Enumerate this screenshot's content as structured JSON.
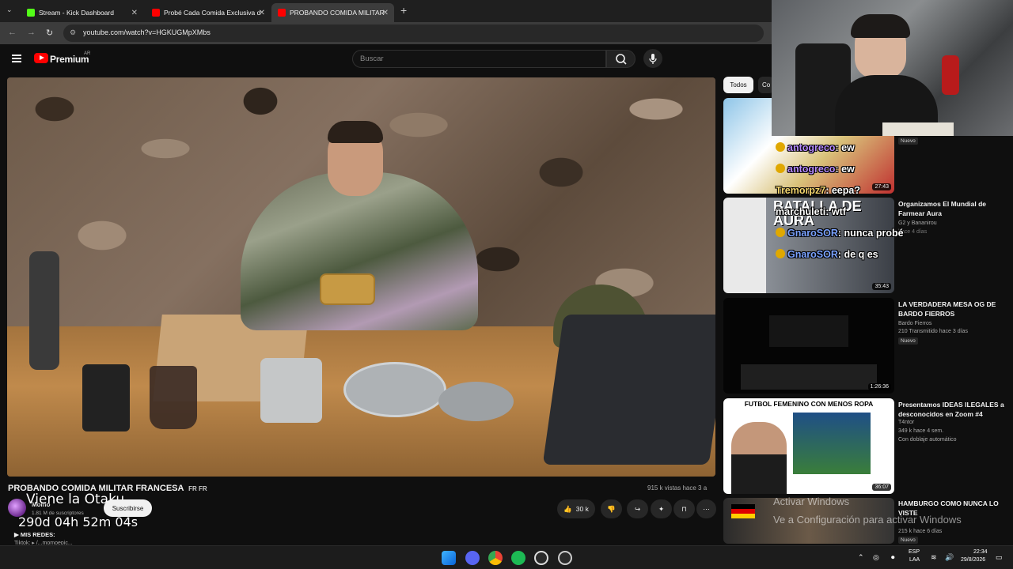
{
  "browser": {
    "tabs": [
      {
        "label": "Stream - Kick Dashboard",
        "favicon_color": "#53fc18"
      },
      {
        "label": "Probé Cada Comida Exclusiva d",
        "favicon_color": "#ff0000"
      },
      {
        "label": "PROBANDO COMIDA MILITAR",
        "favicon_color": "#ff0000"
      }
    ],
    "url": "youtube.com/watch?v=HGKUGMpXMbs"
  },
  "youtube": {
    "logo_text": "Premium",
    "region": "AR",
    "search_placeholder": "Buscar"
  },
  "video": {
    "title": "PROBANDO COMIDA MILITAR FRANCESA",
    "title_flags": "FR FR",
    "views": "915 k vistas",
    "age": "hace 3 a",
    "channel": "Momo",
    "subscribers": "1.81 M de suscriptores",
    "subscribe_label": "Suscribirse",
    "likes": "30 k",
    "description_heading": "▶ MIS REDES:",
    "description_line": "Tiktok: ▸ /...momoepic..."
  },
  "overlay": {
    "countdown_title": "Viene la Otaku",
    "countdown": "290d 04h 52m 04s"
  },
  "chips": [
    "Todos",
    "Co"
  ],
  "recommendations": [
    {
      "title": "",
      "channel": "",
      "meta": "",
      "badge": "Nuevo",
      "duration": "27:43",
      "thumb": "#c03030"
    },
    {
      "title": "Organizamos El Mundial de Farmear Aura",
      "channel": "G2 y Bananirou",
      "meta": "hace 4 días",
      "badge": "Nuevo",
      "duration": "35:43",
      "thumb": "#dddddd"
    },
    {
      "title": "LA VERDADERA MESA OG DE BARDO FIERROS",
      "channel": "Bardo Fierros",
      "meta": "210  Transmitido hace 3 días",
      "badge": "Nuevo",
      "duration": "1:26:36",
      "thumb": "#050505"
    },
    {
      "title": "Presentamos IDEAS ILEGALES a desconocidos en Zoom #4",
      "channel": "T4ntor",
      "meta": "349 k  hace 4 sem.",
      "badge": "Con doblaje automático",
      "duration": "36:07",
      "thumb_text": "FUTBOL FEMENINO CON MENOS ROPA",
      "thumb": "#ffffff"
    },
    {
      "title": "HAMBURGO COMO NUNCA LO VISTE",
      "channel": "",
      "meta": "215 k  hace 6 días",
      "badge": "Nuevo",
      "duration": "",
      "thumb": "#444444"
    }
  ],
  "chat": [
    {
      "user": "antogreco",
      "msg": ": ew",
      "color": "#b78cff"
    },
    {
      "user": "antogreco",
      "msg": ": ew",
      "color": "#b78cff"
    },
    {
      "user": "Tremorpz7",
      "msg": ": eepa?",
      "color": "#f5d76e"
    },
    {
      "user": "marchuleti",
      "msg": ": wtf",
      "color": "#f5f5f5"
    },
    {
      "user": "GnaroSOR",
      "msg": ": nunca probé",
      "color": "#7aa2ff"
    },
    {
      "user": "GnaroSOR",
      "msg": ": de q es",
      "color": "#7aa2ff"
    }
  ],
  "chat_thumb_text": "BATALLA DE AURA",
  "windows_activation": {
    "line1": "Activar Windows",
    "line2": "Ve a Configuración para activar Windows"
  },
  "taskbar": {
    "lang1": "ESP",
    "lang2": "LAA",
    "time": "22:34",
    "date": "29/8/2026"
  }
}
